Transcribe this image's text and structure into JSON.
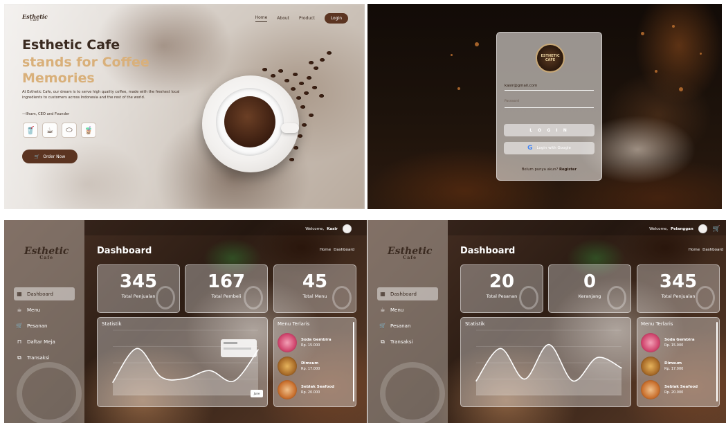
{
  "landing": {
    "brand": "Esthetic",
    "brand_sub": "Cafe",
    "nav": [
      "Home",
      "About",
      "Product"
    ],
    "login_label": "Login",
    "headline_1": "Esthetic Cafe",
    "headline_2": "stands for Coffee",
    "headline_3": "Memories",
    "description": "At Esthetic Cafe, our dream is to serve high quality coffee, made with the freshest local ingredients to customers across Indonesia and the rest of the world.",
    "quote": "—Ilham, CEO and Founder",
    "order_label": "Order Now"
  },
  "login": {
    "logo_text": "ESTHETIC CAFE",
    "email_value": "kasir@gmail.com",
    "password_placeholder": "Password",
    "login_label": "L O G I N",
    "google_label": "Login with Google",
    "register_prefix": "Belum punya akun?",
    "register_link": "Register"
  },
  "dash_kasir": {
    "brand": "Esthetic",
    "brand_sub": "Cafe",
    "welcome_prefix": "Welcome,",
    "user": "Kasir",
    "title": "Dashboard",
    "crumb_home": "Home",
    "crumb_current": "Dashboard",
    "menu": [
      "Dashboard",
      "Menu",
      "Pesanan",
      "Daftar Meja",
      "Transaksi"
    ],
    "stats": [
      {
        "value": "345",
        "label": "Total Penjualan"
      },
      {
        "value": "167",
        "label": "Total Pembeli"
      },
      {
        "value": "45",
        "label": "Total Menu"
      }
    ],
    "chart_title": "Statistik",
    "xbadge": "June",
    "menu_title": "Menu Terlaris",
    "menu_items": [
      {
        "name": "Soda Gembira",
        "price": "Rp. 15.000"
      },
      {
        "name": "Dimsum",
        "price": "Rp. 17.000"
      },
      {
        "name": "Seblak Seafood",
        "price": "Rp. 20.000"
      }
    ]
  },
  "dash_pelanggan": {
    "brand": "Esthetic",
    "brand_sub": "Cafe",
    "welcome_prefix": "Welcome,",
    "user": "Pelanggan",
    "title": "Dashboard",
    "crumb_home": "Home",
    "crumb_current": "Dashboard",
    "menu": [
      "Dashboard",
      "Menu",
      "Pesanan",
      "Transaksi"
    ],
    "stats": [
      {
        "value": "20",
        "label": "Total Pesanan"
      },
      {
        "value": "0",
        "label": "Keranjang"
      },
      {
        "value": "345",
        "label": "Total Penjualan"
      }
    ],
    "chart_title": "Statistik",
    "menu_title": "Menu Terlaris",
    "menu_items": [
      {
        "name": "Soda Gembira",
        "price": "Rp. 15.000"
      },
      {
        "name": "Dimsum",
        "price": "Rp. 17.000"
      },
      {
        "name": "Seblak Seafood",
        "price": "Rp. 20.000"
      }
    ]
  },
  "chart_data": [
    {
      "type": "area",
      "x": [
        1,
        2,
        3,
        4,
        5,
        6,
        7
      ],
      "series": [
        {
          "values": [
            20,
            72,
            28,
            26,
            38,
            22,
            70
          ]
        }
      ]
    },
    {
      "type": "area",
      "x": [
        1,
        2,
        3,
        4,
        5,
        6,
        7
      ],
      "series": [
        {
          "values": [
            22,
            72,
            25,
            78,
            22,
            58,
            42
          ]
        }
      ]
    }
  ],
  "colors": {
    "brand_dark": "#3a2a20",
    "accent_brown": "#5b3421",
    "accent_gold": "#d9b07a"
  }
}
